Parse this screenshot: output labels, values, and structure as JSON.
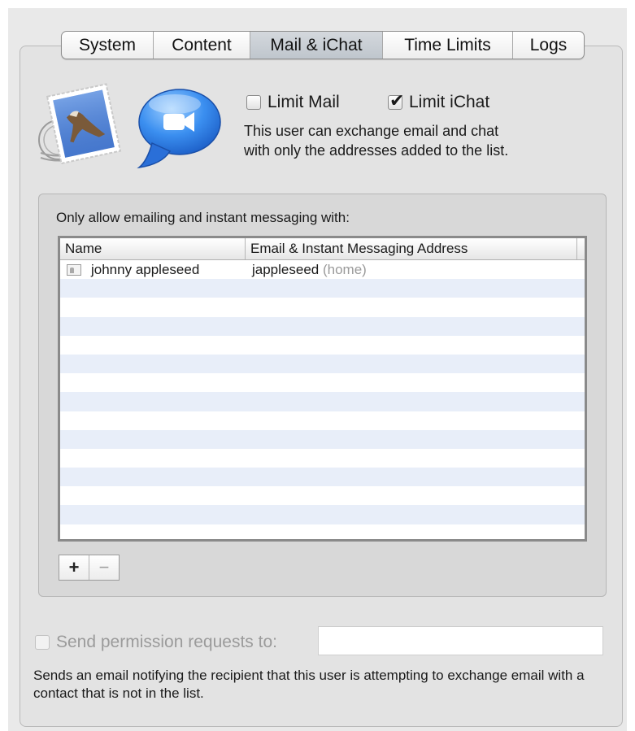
{
  "tabs": [
    {
      "label": "System",
      "width": 112
    },
    {
      "label": "Content",
      "width": 119
    },
    {
      "label": "Mail & iChat",
      "width": 163,
      "selected": true
    },
    {
      "label": "Time Limits",
      "width": 160
    },
    {
      "label": "Logs",
      "width": 88
    }
  ],
  "icons": {
    "mail": "mail-stamp-icon",
    "ichat": "ichat-bubble-icon"
  },
  "limit_mail": {
    "label": "Limit Mail",
    "checked": false
  },
  "limit_ichat": {
    "label": "Limit iChat",
    "checked": true
  },
  "description_line1": "This user can exchange email and chat",
  "description_line2": "with only the addresses added to the list.",
  "list_heading": "Only allow emailing and instant messaging with:",
  "table": {
    "columns": [
      "Name",
      "Email & Instant Messaging Address"
    ],
    "rows": [
      {
        "name": "johnny appleseed",
        "address": "jappleseed",
        "type": "(home)"
      }
    ]
  },
  "buttons": {
    "add": "+",
    "remove": "−"
  },
  "send_permission": {
    "label": "Send permission requests to:",
    "value": ""
  },
  "send_description": "Sends an email notifying the recipient that this user is attempting to exchange email with a contact that is not in the list.",
  "colors": {
    "selected_tab": "#c8ced4",
    "row_alt": "#e8eef9"
  }
}
